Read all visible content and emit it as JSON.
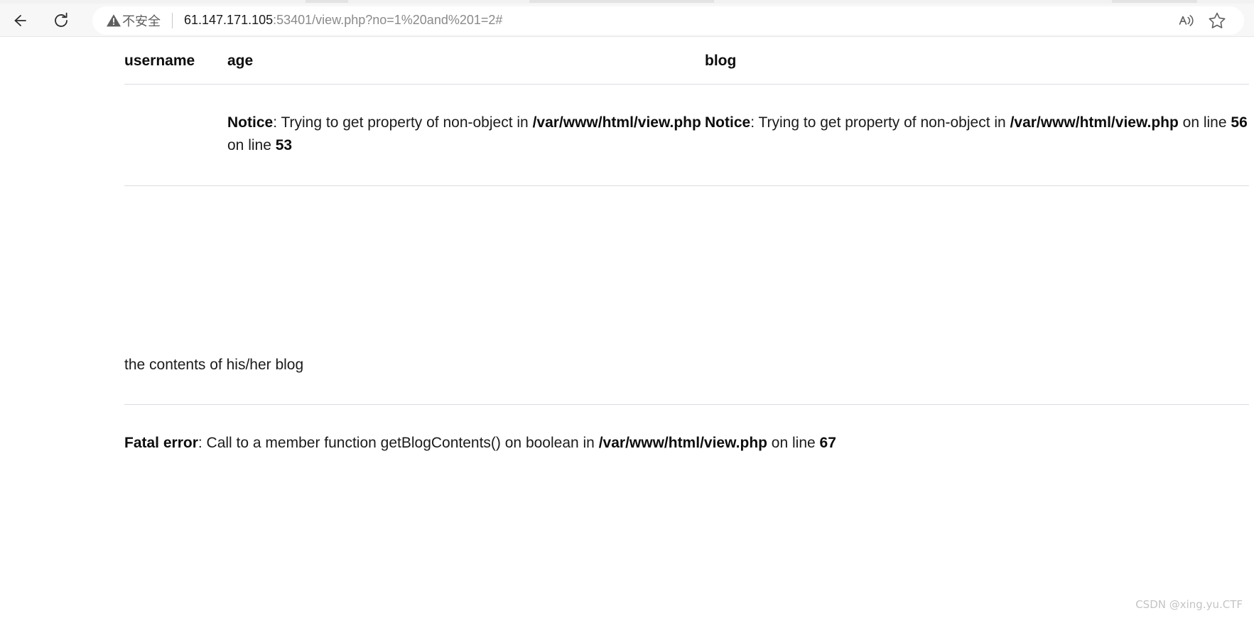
{
  "browser": {
    "back_icon": "back-arrow-icon",
    "refresh_icon": "refresh-icon",
    "security_icon": "warning-triangle-icon",
    "security_label": "不安全",
    "url_host": "61.147.171.105",
    "url_rest": ":53401/view.php?no=1%20and%201=2#",
    "read_aloud_icon": "read-aloud-icon",
    "favorite_icon": "star-icon"
  },
  "table": {
    "headers": [
      "username",
      "age",
      "blog"
    ],
    "rows": [
      {
        "username": "",
        "age": {
          "label": "Notice",
          "message": ": Trying to get property of non-object in ",
          "file": "/var/www/html/view.php",
          "line_prefix": " on line ",
          "line": "53"
        },
        "blog": {
          "label": "Notice",
          "message": ": Trying to get property of non-object in ",
          "file": "/var/www/html/view.php",
          "line_prefix": " on line ",
          "line": "56"
        }
      }
    ]
  },
  "content": {
    "blog_contents_text": "the contents of his/her blog"
  },
  "fatal_error": {
    "label": "Fatal error",
    "message": ": Call to a member function getBlogContents() on boolean in ",
    "file": "/var/www/html/view.php",
    "line_prefix": " on line ",
    "line": "67"
  },
  "watermark": "CSDN @xing.yu.CTF"
}
